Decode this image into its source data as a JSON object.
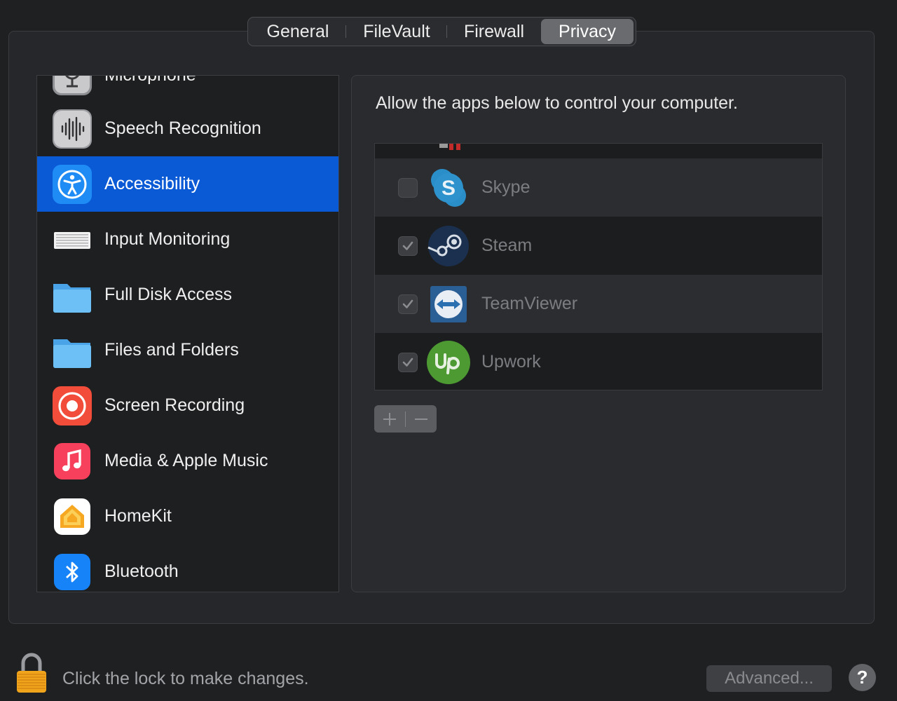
{
  "tabs": [
    {
      "label": "General",
      "active": false
    },
    {
      "label": "FileVault",
      "active": false
    },
    {
      "label": "Firewall",
      "active": false
    },
    {
      "label": "Privacy",
      "active": true
    }
  ],
  "sidebar": {
    "items": [
      {
        "label": "Microphone",
        "icon": "microphone-icon"
      },
      {
        "label": "Speech Recognition",
        "icon": "speech-recognition-icon"
      },
      {
        "label": "Accessibility",
        "icon": "accessibility-icon",
        "selected": true
      },
      {
        "label": "Input Monitoring",
        "icon": "keyboard-icon"
      },
      {
        "label": "Full Disk Access",
        "icon": "folder-icon"
      },
      {
        "label": "Files and Folders",
        "icon": "folder-icon"
      },
      {
        "label": "Screen Recording",
        "icon": "screen-recording-icon"
      },
      {
        "label": "Media & Apple Music",
        "icon": "music-icon"
      },
      {
        "label": "HomeKit",
        "icon": "home-icon"
      },
      {
        "label": "Bluetooth",
        "icon": "bluetooth-icon"
      }
    ]
  },
  "main": {
    "instruction": "Allow the apps below to control your computer.",
    "apps": [
      {
        "name": "Skype",
        "checked": false,
        "icon": "skype-icon"
      },
      {
        "name": "Steam",
        "checked": true,
        "icon": "steam-icon"
      },
      {
        "name": "TeamViewer",
        "checked": true,
        "icon": "teamviewer-icon"
      },
      {
        "name": "Upwork",
        "checked": true,
        "icon": "upwork-icon"
      }
    ],
    "add_label": "+",
    "remove_label": "−"
  },
  "footer": {
    "lock_text": "Click the lock to make changes.",
    "advanced_label": "Advanced...",
    "help_label": "?"
  },
  "colors": {
    "selection": "#0a5ad6",
    "background": "#1f2022"
  }
}
